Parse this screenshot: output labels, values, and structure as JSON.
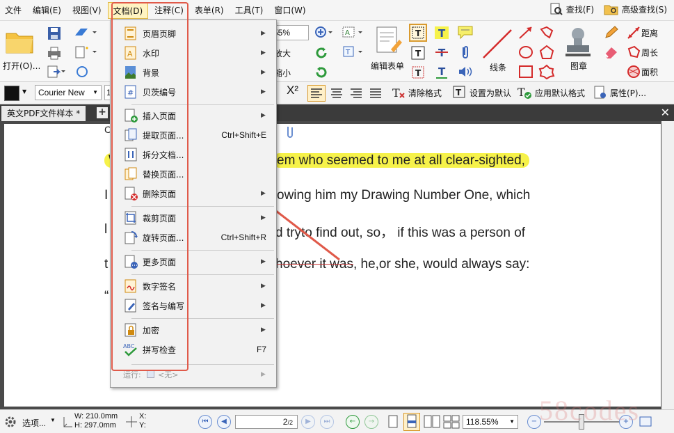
{
  "menubar": {
    "items": [
      "文件",
      "编辑(E)",
      "视图(V)",
      "文档(D)",
      "注释(C)",
      "表单(R)",
      "工具(T)",
      "窗口(W)"
    ],
    "find_label": "查找(F)",
    "advanced_find_label": "高级查找(S)"
  },
  "ribbon": {
    "open_label": "打开(O)...",
    "zoom_value": "55%",
    "zoom_in_label": "放大",
    "zoom_out_label": "缩小",
    "edit_form_label": "编辑表单",
    "lines_label": "线条",
    "stamp_label": "图章",
    "distance_label": "距离",
    "perimeter_label": "周长",
    "area_label": "面积"
  },
  "formatbar": {
    "font": "Courier New",
    "font_size": "1",
    "clear_format_label": "清除格式",
    "set_default_label": "设置为默认",
    "apply_default_label": "应用默认格式",
    "properties_label": "属性(P)..."
  },
  "tab": {
    "title": "英文PDF文件样本 *"
  },
  "document": {
    "line1": "em who seemed to me at all clear-sighted,",
    "line2": "owing him my Drawing Number One, which",
    "line3": "d tryto find out, so，  if this was a person of",
    "line4_strike": "hoever it was",
    "line4_rest": ",    he,or she, would always say:",
    "prefix1": "W",
    "prefix2": "I",
    "prefix3": "l",
    "prefix4": "t",
    "prefix5": "“",
    "prefix0": "C"
  },
  "dropdown": {
    "items": [
      {
        "label": "页眉页脚",
        "shortcut": ""
      },
      {
        "label": "水印",
        "shortcut": ""
      },
      {
        "label": "背景",
        "shortcut": ""
      },
      {
        "label": "贝茨编号",
        "shortcut": ""
      },
      {
        "label": "插入页面",
        "shortcut": ""
      },
      {
        "label": "提取页面...",
        "shortcut": "Ctrl+Shift+E"
      },
      {
        "label": "拆分文档...",
        "shortcut": ""
      },
      {
        "label": "替换页面...",
        "shortcut": ""
      },
      {
        "label": "删除页面",
        "shortcut": ""
      },
      {
        "label": "裁剪页面",
        "shortcut": ""
      },
      {
        "label": "旋转页面...",
        "shortcut": "Ctrl+Shift+R"
      },
      {
        "label": "更多页面",
        "shortcut": ""
      },
      {
        "label": "数字签名",
        "shortcut": ""
      },
      {
        "label": "签名与编写",
        "shortcut": ""
      },
      {
        "label": "加密",
        "shortcut": ""
      },
      {
        "label": "拼写检查",
        "shortcut": "F7"
      }
    ],
    "run_label": "运行:",
    "run_value": "<无>"
  },
  "statusbar": {
    "options_label": "选项...",
    "width": "W: 210.0mm",
    "height": "H: 297.0mm",
    "x_label": "X:",
    "y_label": "Y:",
    "page_value": "2",
    "page_total": "/2",
    "zoom": "118.55%"
  },
  "watermark": "58codes",
  "colors": {
    "highlight": "#f6f24a",
    "annotation_red": "#e05a4a",
    "menu_active": "#fff4c2"
  }
}
